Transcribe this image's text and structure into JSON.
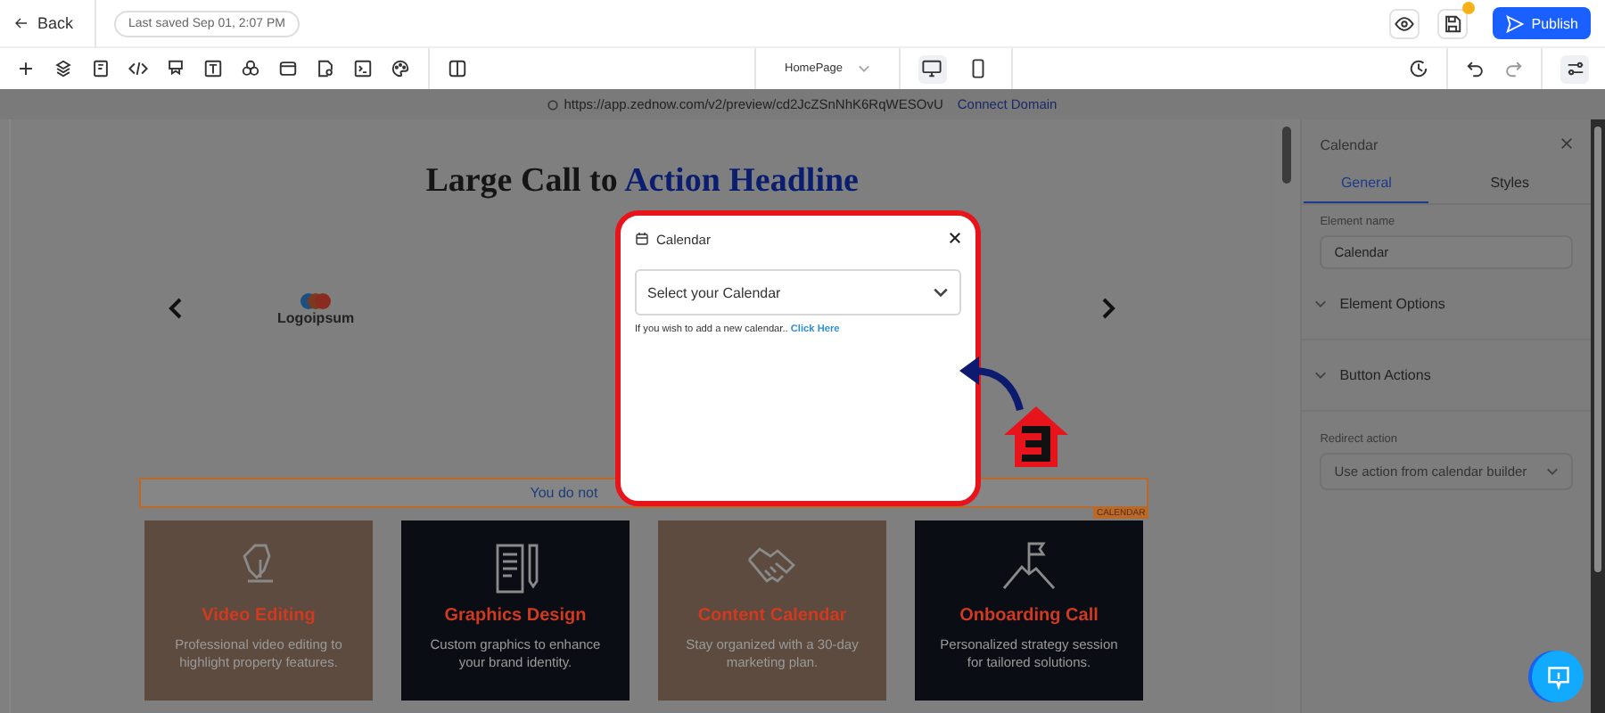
{
  "top_bar": {
    "back": "Back",
    "last_saved": "Last saved Sep 01, 2:07 PM",
    "unsaved": true,
    "publish": "Publish"
  },
  "toolbar": {
    "page_select": "HomePage",
    "devices": [
      {
        "kind": "desktop",
        "selected": true
      },
      {
        "kind": "mobile",
        "selected": false
      }
    ]
  },
  "url_bar": {
    "url": "https://app.zednow.com/v2/preview/cd2JcZSnNhK6RqWESOvU",
    "link": "Connect Domain"
  },
  "canvas": {
    "headline": {
      "text": "Large Call to ",
      "highlight": "Action Headline"
    },
    "logo": "Logoipsum",
    "notice": "You do not",
    "element_tag": "CALENDAR",
    "cards": [
      {
        "kind": "pen",
        "color": "#5c4b3e",
        "title": "Video Editing",
        "description": "Professional video editing to highlight property features."
      },
      {
        "kind": "document",
        "color": "#0a0d14",
        "title": "Graphics Design",
        "description": "Custom graphics to enhance your brand identity."
      },
      {
        "kind": "handshake",
        "color": "#5c4b3e",
        "title": "Content Calendar",
        "description": "Stay organized with a 30-day marketing plan."
      },
      {
        "kind": "flag",
        "color": "#0a0d14",
        "title": "Onboarding Call",
        "description": "Personalized strategy session for tailored solutions."
      }
    ]
  },
  "modal": {
    "title": "Calendar",
    "placeholder": "Select your Calendar",
    "hint": "If you wish to add a new calendar..",
    "link": "Click Here"
  },
  "panel": {
    "title": "Calendar",
    "tabs": [
      {
        "label": "General",
        "selected": true
      },
      {
        "label": "Styles",
        "selected": false
      }
    ],
    "element_name_label": "Element name",
    "element_name": "Calendar",
    "sections": [
      "Element Options",
      "Button Actions"
    ],
    "redirect_label": "Redirect action",
    "redirect_value": "Use action from calendar builder"
  }
}
